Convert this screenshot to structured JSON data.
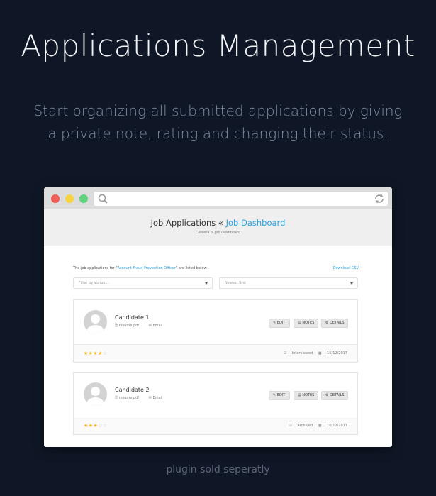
{
  "hero": {
    "title": "Applications Management",
    "subtitle": "Start organizing all submitted applications by giving a private note, rating and changing their status.",
    "footer": "plugin sold seperatly"
  },
  "page": {
    "title_prefix": "Job Applications « ",
    "title_link": "Job Dashboard",
    "breadcrumb": "Careera  >  Job Dashboard",
    "intro_before": "The job applications for \"",
    "intro_job": "Account Fraud Prevention Officer",
    "intro_after": "\" are listed below.",
    "download_label": "Download CSV",
    "filter_placeholder": "Filter by status...",
    "sort_selected": "Newest first"
  },
  "buttons": {
    "edit": "EDIT",
    "notes": "NOTES",
    "details": "DETAILS"
  },
  "candidates": [
    {
      "name": "Candidate 1",
      "resume": "resume.pdf",
      "email": "Email",
      "rating": 4,
      "stars_on": "★★★★",
      "stars_off": "☆",
      "status": "Interviewed",
      "date": "15/12/2017"
    },
    {
      "name": "Candidate 2",
      "resume": "resume.pdf",
      "email": "Email",
      "rating": 3,
      "stars_on": "★★★",
      "stars_off": "☆☆",
      "status": "Archived",
      "date": "10/12/2017"
    }
  ],
  "colors": {
    "background": "#0f1726",
    "accent": "#2aa3dd",
    "star": "#f3b51f"
  }
}
